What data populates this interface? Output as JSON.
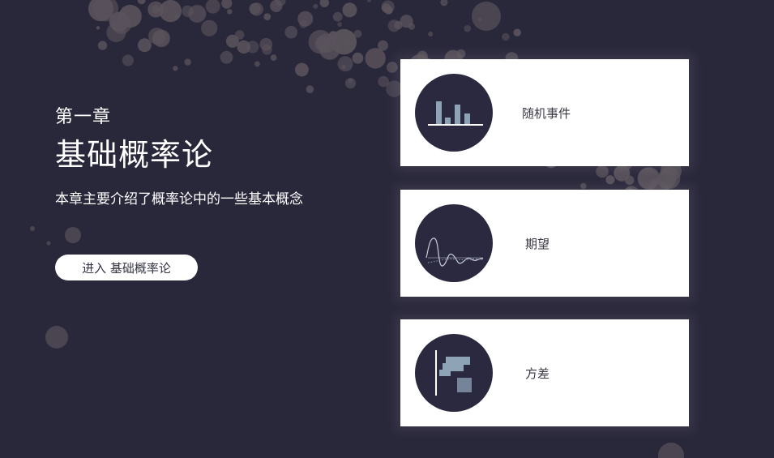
{
  "hero": {
    "chapter": "第一章",
    "title": "基础概率论",
    "description": "本章主要介绍了概率论中的一些基本概念",
    "enter_button": "进入 基础概率论"
  },
  "cards": [
    {
      "label": "随机事件",
      "icon": "bar-chart-icon"
    },
    {
      "label": "期望",
      "icon": "wave-icon"
    },
    {
      "label": "方差",
      "icon": "histogram-icon"
    }
  ],
  "colors": {
    "background": "#29273a",
    "bubble": "#5a535c",
    "card": "#ffffff",
    "icon_circle": "#2b2940",
    "icon_accent": "#8fa3b6"
  }
}
